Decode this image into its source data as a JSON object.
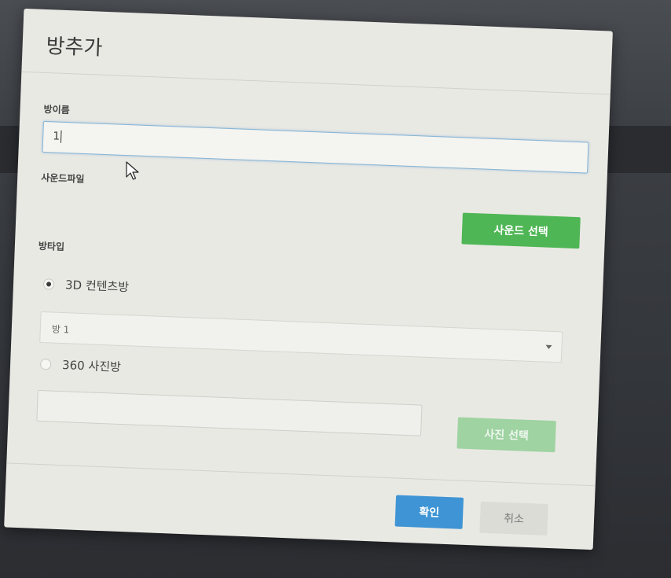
{
  "dialog": {
    "title": "방추가",
    "room_name": {
      "label": "방이름",
      "value": "1"
    },
    "sound_file": {
      "label": "사운드파일",
      "value": "",
      "select_button": "사운드 선택"
    },
    "room_type": {
      "label": "방타입",
      "options": [
        {
          "label": "3D 컨텐츠방",
          "checked": true
        },
        {
          "label": "360 사진방",
          "checked": false
        }
      ],
      "content_select": {
        "selected": "방 1"
      },
      "photo_file": {
        "value": "",
        "select_button": "사진 선택",
        "disabled": true
      }
    },
    "footer": {
      "confirm": "확인",
      "cancel": "취소"
    }
  },
  "colors": {
    "green": "#4fb655",
    "green_disabled": "#9fd3a2",
    "blue": "#3e94d4",
    "dialog_bg": "#e9e9e4"
  },
  "icons": [
    "mouse-pointer-icon",
    "chevron-down-icon",
    "radio-checked-icon",
    "radio-unchecked-icon"
  ]
}
